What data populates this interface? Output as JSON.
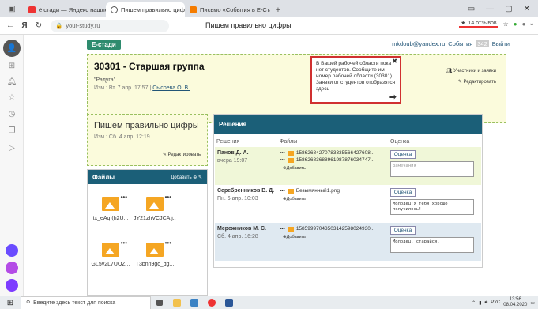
{
  "browser": {
    "tabs": [
      {
        "label": "ё стади — Яндекс нашлос",
        "fav_color": "#e33"
      },
      {
        "label": "Пишем правильно циф",
        "fav_color": "#555",
        "active": true
      },
      {
        "label": "Письмо «События в Е-Ста",
        "fav_color": "#f57c00"
      }
    ],
    "back": "←",
    "brand_letter": "Я",
    "reload": "↻",
    "url": "your-study.ru",
    "page_title": "Пишем правильно цифры",
    "reviews": "14 отзывов",
    "tab_close": "×",
    "new_tab": "+",
    "window_controls": [
      "▭",
      "—",
      "▢",
      "✕"
    ]
  },
  "site": {
    "logo": "Е-стади",
    "user_email": "mkdoub@yandex.ru",
    "events_label": "События",
    "events_count": "342",
    "logout_label": "Выйти"
  },
  "group": {
    "title": "30301 - Старшая группа",
    "subtitle": "\"Радуга\"",
    "meta_prefix": "Изм.: Вт. 7 апр. 17:57 |",
    "author": "Сысоева О. В.",
    "tooltip_text": "В Вашей рабочей области пока нет студентов. Сообщите им номер рабочей области (30301). Заявки от студентов отобразятся здесь",
    "tooltip_close": "✖",
    "tooltip_arrow": "➡",
    "participants_label": "Участники и заявки",
    "edit_label": "Редактировать"
  },
  "topic": {
    "title": "Пишем правильно цифры",
    "meta": "Изм.: Сб. 4 апр. 12:19",
    "edit_label": "Редактировать"
  },
  "files": {
    "header": "Файлы",
    "add_label": "Добавить",
    "items": [
      {
        "name": "tx_eAqI(h2U..."
      },
      {
        "name": "JY21zhVCJCA.j..."
      },
      {
        "name": "GL5v2L7UOZ..."
      },
      {
        "name": "T3bnn9gc_dg..."
      }
    ]
  },
  "solutions": {
    "header": "Решения",
    "col_solutions": "Решения",
    "col_files": "Файлы",
    "col_grade": "Оценка",
    "add_label": "Добавить",
    "grade_button": "Оценка",
    "rows": [
      {
        "name": "Панов Д. А.",
        "date": "вчера 19:07",
        "files": [
          "158626842707833355664276​08...",
          "158626836889619878760347​47..."
        ],
        "comment": "Замечания",
        "comment_placeholder": true
      },
      {
        "name": "Серебренников В. Д.",
        "date": "Пн. 6 апр. 10:03",
        "files": [
          "Безымянный1.png"
        ],
        "comment": "Молодец!У тебя хорошо получилось!",
        "comment_placeholder": false
      },
      {
        "name": "Мережников М. С.",
        "date": "Сб. 4 апр. 16:28",
        "files": [
          "158599970435031425980249​30..."
        ],
        "comment": "Молодец, старайся.",
        "comment_placeholder": false
      }
    ]
  },
  "taskbar": {
    "search_placeholder": "Введите здесь текст для поиска",
    "time": "13:56",
    "date": "08.04.2020",
    "lang": "РУС"
  }
}
